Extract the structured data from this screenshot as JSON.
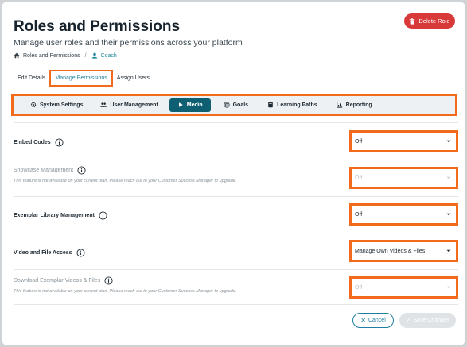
{
  "header": {
    "title": "Roles and Permissions",
    "subtitle": "Manage user roles and their permissions across your platform",
    "delete_label": "Delete Role"
  },
  "breadcrumb": {
    "root": "Roles and Permissions",
    "separator": "/",
    "current": "Coach"
  },
  "tabs": [
    {
      "label": "Edit Details"
    },
    {
      "label": "Manage Permissions",
      "active": true
    },
    {
      "label": "Assign Users"
    }
  ],
  "subnav": [
    {
      "label": "System Settings",
      "icon": "gear-icon"
    },
    {
      "label": "User Management",
      "icon": "users-icon"
    },
    {
      "label": "Media",
      "icon": "play-icon",
      "active": true
    },
    {
      "label": "Goals",
      "icon": "target-icon"
    },
    {
      "label": "Learning Paths",
      "icon": "book-icon"
    },
    {
      "label": "Reporting",
      "icon": "chart-icon"
    }
  ],
  "settings": [
    {
      "label": "Embed Codes",
      "value": "Off",
      "enabled": true,
      "note": ""
    },
    {
      "label": "Showcase Management",
      "value": "Off",
      "enabled": false,
      "note": "This feature is not available on your current plan. Please reach out to your Customer Success Manager to upgrade."
    },
    {
      "label": "Exemplar Library Management",
      "value": "Off",
      "enabled": true,
      "note": ""
    },
    {
      "label": "Video and File Access",
      "value": "Manage Own Videos & Files",
      "enabled": true,
      "note": ""
    },
    {
      "label": "Download Exemplar Videos & Files",
      "value": "Off",
      "enabled": false,
      "note": "This feature is not available on your current plan. Please reach out to your Customer Success Manager to upgrade."
    }
  ],
  "footer": {
    "cancel_label": "Cancel",
    "save_label": "Save Changes"
  },
  "colors": {
    "accent": "#1e7ea1",
    "active_tab_bg": "#0f5f72",
    "danger": "#d83a3a",
    "highlight": "#f26b1d"
  }
}
